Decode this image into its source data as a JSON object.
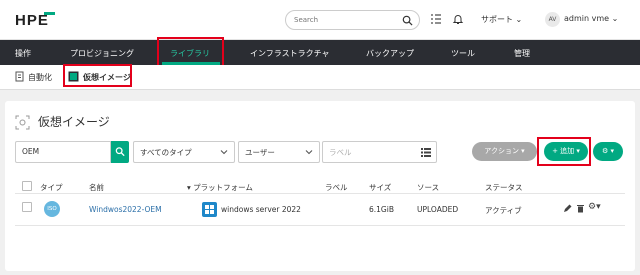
{
  "header": {
    "logo": "HPE",
    "search_placeholder": "Search",
    "support": "サポート",
    "avatar": "AV",
    "user": "admin vme"
  },
  "nav": {
    "items": [
      "操作",
      "プロビジョニング",
      "ライブラリ",
      "インフラストラクチャ",
      "バックアップ",
      "ツール",
      "管理"
    ],
    "active": "ライブラリ"
  },
  "subnav": {
    "items": [
      "自動化",
      "仮想イメージ"
    ],
    "active": "仮想イメージ"
  },
  "page": {
    "title": "仮想イメージ",
    "search_value": "OEM",
    "type_filter": "すべてのタイプ",
    "user_filter": "ユーザー",
    "label_placeholder": "ラベル",
    "actions_label": "アクション",
    "add_label": "+ 追加"
  },
  "table": {
    "headers": [
      "タイプ",
      "名前",
      "プラットフォーム",
      "ラベル",
      "サイズ",
      "ソース",
      "ステータス"
    ],
    "rows": [
      {
        "type": "ISO",
        "name": "Windwos2022-OEM",
        "platform": "windows server 2022",
        "label": "",
        "size": "6.1GiB",
        "source": "UPLOADED",
        "status": "アクティブ"
      }
    ]
  },
  "colors": {
    "accent": "#01a982",
    "nav_bg": "#2b2d33",
    "highlight": "#e3001b",
    "iso_badge": "#66b7df"
  }
}
